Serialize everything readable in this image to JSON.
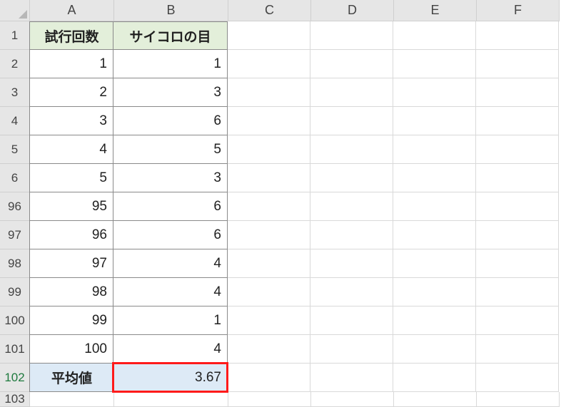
{
  "columns": [
    "A",
    "B",
    "C",
    "D",
    "E",
    "F"
  ],
  "row_labels": [
    "1",
    "2",
    "3",
    "4",
    "5",
    "6",
    "96",
    "97",
    "98",
    "99",
    "100",
    "101",
    "102",
    "103"
  ],
  "selected_row_index": 12,
  "headers": {
    "A": "試行回数",
    "B": "サイコロの目"
  },
  "rows": [
    {
      "trial": "1",
      "die": "1"
    },
    {
      "trial": "2",
      "die": "3"
    },
    {
      "trial": "3",
      "die": "6"
    },
    {
      "trial": "4",
      "die": "5"
    },
    {
      "trial": "5",
      "die": "3"
    },
    {
      "trial": "95",
      "die": "6"
    },
    {
      "trial": "96",
      "die": "6"
    },
    {
      "trial": "97",
      "die": "4"
    },
    {
      "trial": "98",
      "die": "4"
    },
    {
      "trial": "99",
      "die": "1"
    },
    {
      "trial": "100",
      "die": "4"
    }
  ],
  "summary": {
    "label": "平均値",
    "value": "3.67"
  }
}
